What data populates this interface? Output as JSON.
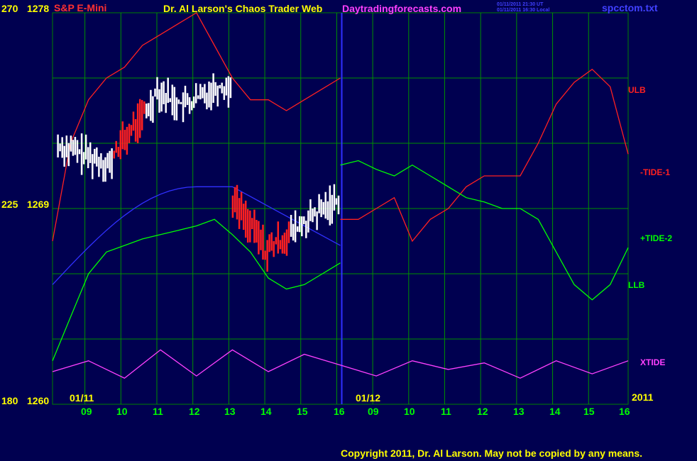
{
  "header": {
    "title_left": "S&P E-Mini",
    "title_main": "Dr. Al Larson's Chaos Trader Web",
    "site": "Daytradingforecasts.com",
    "stamp_ut": "01/11/2011 21:30 UT",
    "stamp_local": "01/11/2011 16:30 Local",
    "filename": "spcctom.txt"
  },
  "y_axis": {
    "top_a": "270",
    "top_b": "1278",
    "mid_a": "225",
    "mid_b": "1269",
    "bot_a": "180",
    "bot_b": "1260"
  },
  "x_axis": {
    "date_start": "01/11",
    "date_next": "01/12",
    "year": "2011",
    "hours": [
      "09",
      "10",
      "11",
      "12",
      "13",
      "14",
      "15",
      "16",
      "09",
      "10",
      "11",
      "12",
      "13",
      "14",
      "15",
      "16"
    ]
  },
  "legend": [
    {
      "label": "ULB",
      "color": "#ff2020"
    },
    {
      "label": "-TIDE-1",
      "color": "#ff2020"
    },
    {
      "label": "+TIDE-2",
      "color": "#00ff00"
    },
    {
      "label": "LLB",
      "color": "#00ff00"
    },
    {
      "label": "XTIDE",
      "color": "#ff40ff"
    }
  ],
  "footer": {
    "copyright": "Copyright 2011, Dr. Al Larson. May not be copied by any means."
  },
  "chart_data": {
    "type": "line",
    "price_range": [
      1260,
      1278
    ],
    "grid": true,
    "x_hours": [
      "09",
      "10",
      "11",
      "12",
      "13",
      "14",
      "15",
      "16",
      "09",
      "10",
      "11",
      "12",
      "13",
      "14",
      "15",
      "16"
    ],
    "series": [
      {
        "name": "ULB",
        "color": "#ff2020",
        "x": [
          0,
          0.5,
          1,
          1.5,
          2,
          2.5,
          3,
          3.5,
          4,
          4.5,
          5,
          5.5,
          6,
          6.5,
          7,
          7.5,
          8
        ],
        "y": [
          1267.5,
          1272,
          1274,
          1275,
          1275.5,
          1276.5,
          1277,
          1277.5,
          1278,
          1276.5,
          1275,
          1274,
          1274,
          1273.5,
          1274,
          1274.5,
          1275
        ]
      },
      {
        "name": "-TIDE-1",
        "color": "#ff2020",
        "x": [
          8,
          8.5,
          9,
          9.5,
          10,
          10.5,
          11,
          11.5,
          12,
          12.5,
          13,
          13.5,
          14,
          14.5,
          15,
          15.5,
          16
        ],
        "y": [
          1268.5,
          1268.5,
          1269,
          1269.5,
          1267.5,
          1268.5,
          1269,
          1270,
          1270.5,
          1270.5,
          1270.5,
          1272,
          1273.8,
          1274.8,
          1275.4,
          1274.6,
          1271.5
        ]
      },
      {
        "name": "+TIDE-2",
        "color": "#00ff00",
        "x": [
          8,
          8.5,
          9,
          9.5,
          10,
          10.5,
          11,
          11.5,
          12,
          12.5,
          13,
          13.5,
          14,
          14.5,
          15,
          15.5,
          16
        ],
        "y": [
          1271,
          1271.2,
          1270.8,
          1270.5,
          1271,
          1270.5,
          1270,
          1269.5,
          1269.3,
          1269,
          1269,
          1268.5,
          1267,
          1265.5,
          1264.8,
          1265.5,
          1267.2
        ]
      },
      {
        "name": "LLB",
        "color": "#00ff00",
        "x": [
          0,
          0.5,
          1,
          1.5,
          2,
          2.5,
          3,
          3.5,
          4,
          4.5,
          5,
          5.5,
          6,
          6.5,
          7,
          7.5,
          8
        ],
        "y": [
          1262,
          1264,
          1266,
          1267,
          1267.3,
          1267.6,
          1267.8,
          1268,
          1268.2,
          1268.5,
          1267.8,
          1267,
          1265.8,
          1265.3,
          1265.5,
          1266,
          1266.5
        ]
      },
      {
        "name": "XTIDE",
        "color": "#ff40ff",
        "x": [
          0,
          1,
          2,
          3,
          4,
          5,
          6,
          7,
          8,
          9,
          10,
          11,
          12,
          13,
          14,
          15,
          16
        ],
        "y": [
          1261.5,
          1262,
          1261.2,
          1262.5,
          1261.3,
          1262.5,
          1261.5,
          1262.3,
          1261.8,
          1261.3,
          1262,
          1261.6,
          1261.9,
          1261.2,
          1262,
          1261.4,
          1262
        ]
      }
    ]
  }
}
